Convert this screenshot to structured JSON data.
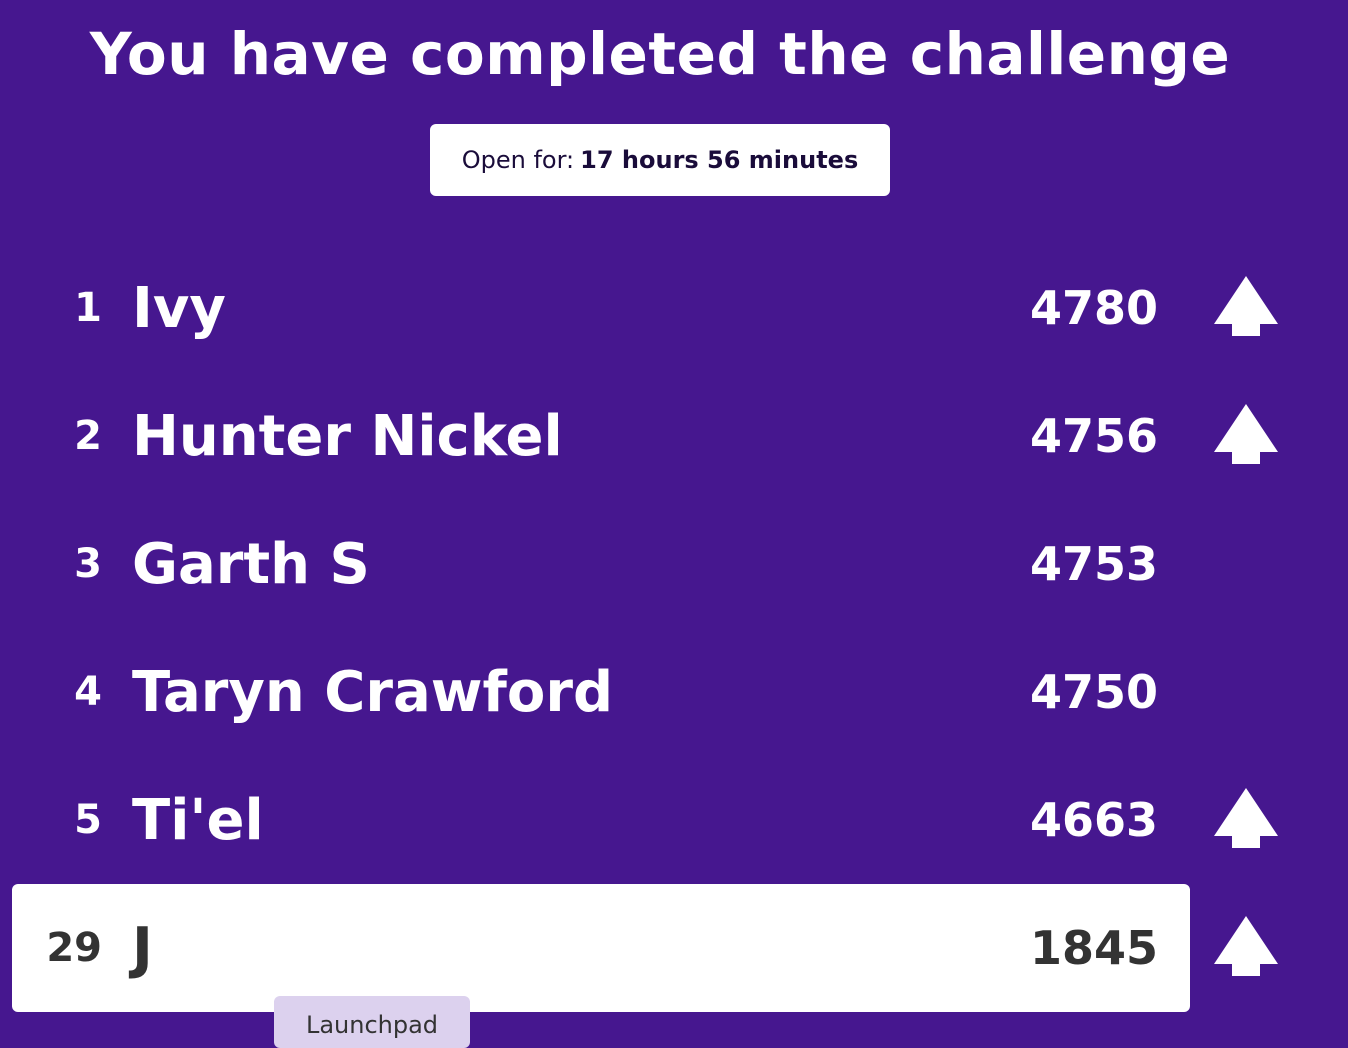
{
  "title": "You have completed the challenge",
  "timer": {
    "label": "Open for:",
    "value": "17 hours 56 minutes"
  },
  "leaderboard": [
    {
      "rank": "1",
      "name": "Ivy",
      "score": "4780",
      "trend": "up"
    },
    {
      "rank": "2",
      "name": "Hunter Nickel",
      "score": "4756",
      "trend": "up"
    },
    {
      "rank": "3",
      "name": "Garth S",
      "score": "4753",
      "trend": "none"
    },
    {
      "rank": "4",
      "name": "Taryn Crawford",
      "score": "4750",
      "trend": "none"
    },
    {
      "rank": "5",
      "name": "Ti'el",
      "score": "4663",
      "trend": "up"
    }
  ],
  "current_player": {
    "rank": "29",
    "name": "J",
    "score": "1845",
    "trend": "up"
  },
  "tooltip": "Launchpad",
  "colors": {
    "background": "#46178f",
    "card": "#ffffff",
    "player_text": "#333333",
    "tooltip_bg": "#dcd1ee"
  },
  "icons": {
    "trend_up": "arrow-up-icon"
  }
}
